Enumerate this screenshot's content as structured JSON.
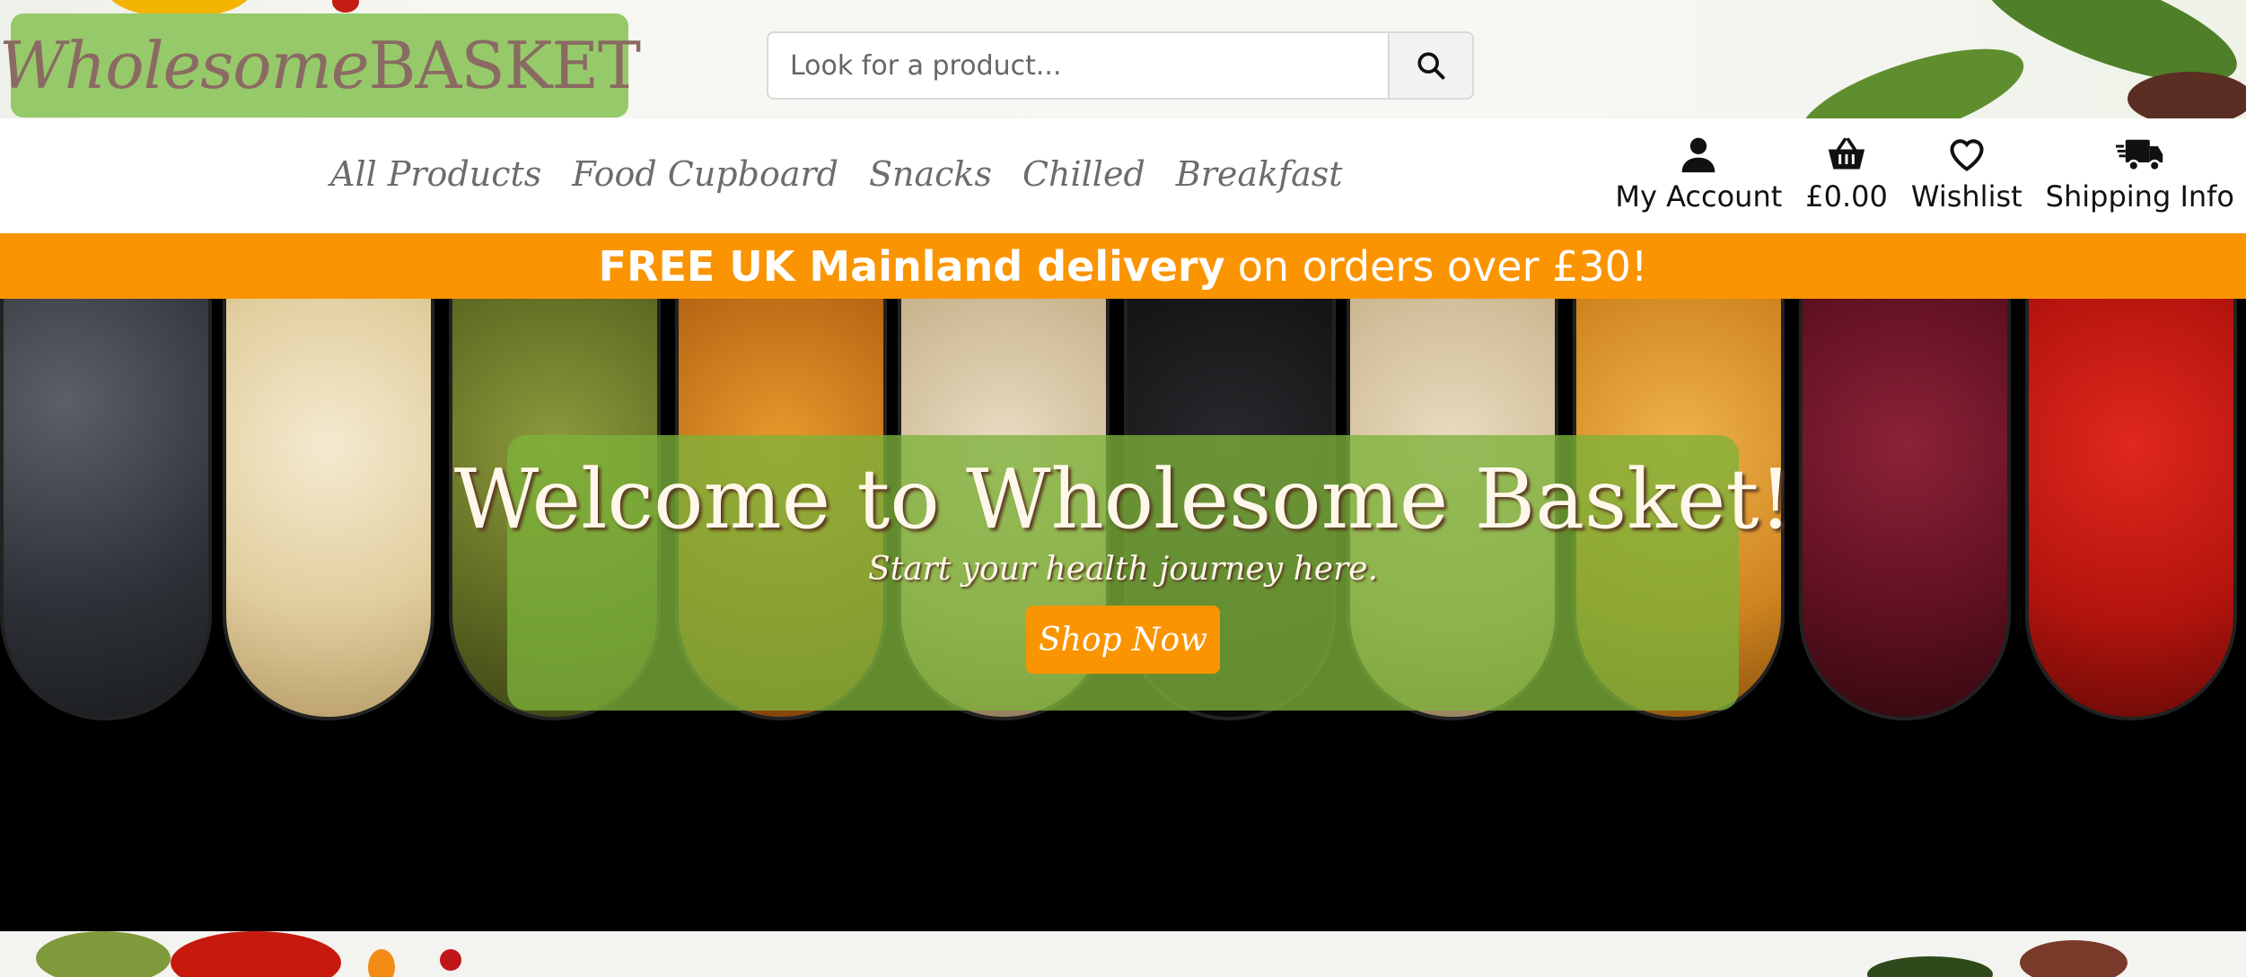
{
  "header": {
    "logo": {
      "part1": "Wholesome",
      "part2": "BASKET"
    },
    "search": {
      "placeholder": "Look for a product..."
    },
    "icons": {
      "search": "search-icon"
    }
  },
  "nav": {
    "links": [
      "All Products",
      "Food Cupboard",
      "Snacks",
      "Chilled",
      "Breakfast"
    ],
    "icons": [
      {
        "label": "My Account",
        "icon": "user-icon"
      },
      {
        "label": "£0.00",
        "icon": "basket-icon"
      },
      {
        "label": "Wishlist",
        "icon": "heart-icon"
      },
      {
        "label": "Shipping Info",
        "icon": "truck-icon"
      }
    ]
  },
  "promo": {
    "strong": "FREE UK Mainland delivery",
    "rest": "on orders over £30!"
  },
  "hero": {
    "title": "Welcome to Wholesome Basket!",
    "subtitle": "Start your health journey here.",
    "cta": "Shop Now"
  },
  "colors": {
    "logo_bg": "#96c96a",
    "promo_bg": "#fb9401",
    "hero_card": "#7cb23a",
    "cta_bg": "#fb9401"
  }
}
